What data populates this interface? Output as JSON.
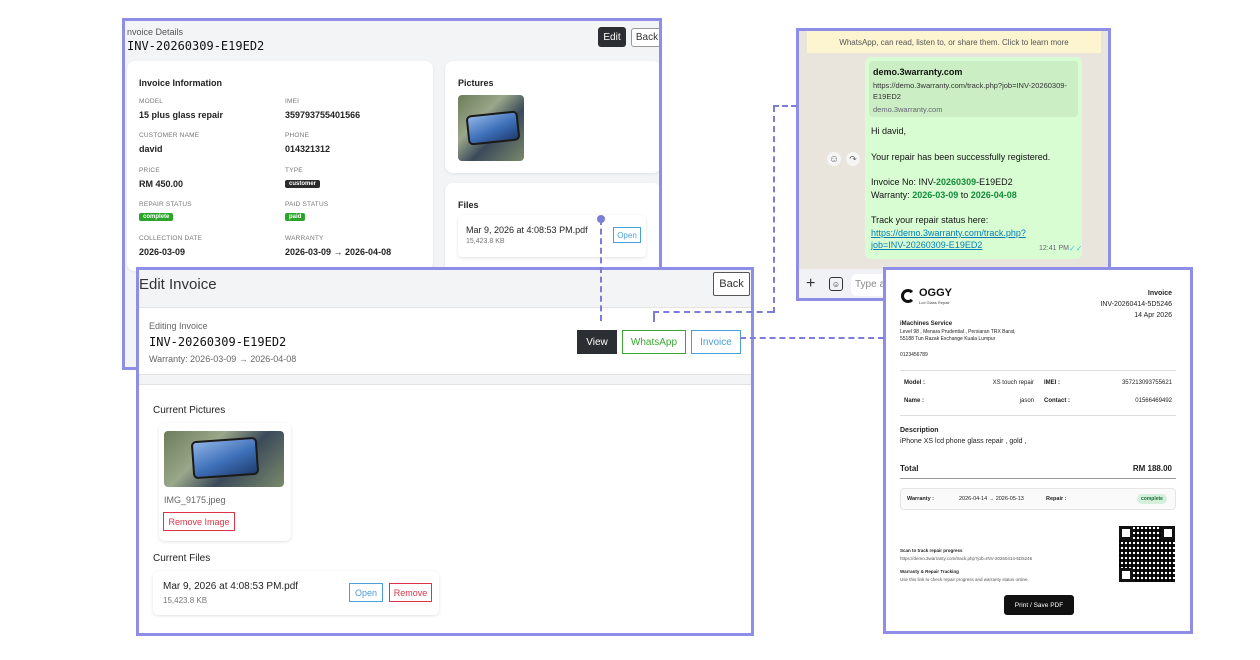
{
  "details": {
    "label": "nvoice Details",
    "invoice_id": "INV-20260309-E19ED2",
    "edit_label": "Edit",
    "back_label": "Back",
    "info_title": "Invoice Information",
    "model_label": "MODEL",
    "model": "15 plus glass repair",
    "imei_label": "IMEI",
    "imei": "359793755401566",
    "customer_label": "CUSTOMER NAME",
    "customer": "david",
    "phone_label": "PHONE",
    "phone": "014321312",
    "price_label": "PRICE",
    "price": "RM 450.00",
    "type_label": "TYPE",
    "type": "customer",
    "repair_status_label": "REPAIR STATUS",
    "repair_status": "complete",
    "paid_status_label": "PAID STATUS",
    "paid_status": "paid",
    "collection_label": "COLLECTION DATE",
    "collection": "2026-03-09",
    "warranty_label": "WARRANTY",
    "warranty": "2026-03-09 → 2026-04-08",
    "pictures_title": "Pictures",
    "files_title": "Files",
    "file_name": "Mar 9, 2026 at 4:08:53 PM.pdf",
    "file_size": "15,423.8 KB",
    "open_label": "Open"
  },
  "edit": {
    "title": "Edit Invoice",
    "back_label": "Back",
    "editing_label": "Editing Invoice",
    "invoice_id": "INV-20260309-E19ED2",
    "warranty": "Warranty: 2026-03-09 → 2026-04-08",
    "view_label": "View",
    "whatsapp_label": "WhatsApp",
    "invoice_label": "Invoice",
    "pictures_title": "Current Pictures",
    "image_name": "IMG_9175.jpeg",
    "remove_image_label": "Remove Image",
    "files_title": "Current Files",
    "file_name": "Mar 9, 2026 at 4:08:53 PM.pdf",
    "file_size": "15,423.8 KB",
    "open_label": "Open",
    "remove_label": "Remove"
  },
  "whatsapp": {
    "banner": "WhatsApp, can read, listen to, or share them. Click to learn more",
    "preview_title": "demo.3warranty.com",
    "preview_url_1": "https://demo.3warranty.com/track.php?job=INV-20260309-",
    "preview_url_2": "E19ED2",
    "preview_domain": "demo.3warranty.com",
    "greeting": "Hi david,",
    "registered": "Your repair has been successfully registered.",
    "invoice_prefix": "Invoice No: INV-",
    "invoice_bold": "20260309",
    "invoice_suffix": "-E19ED2",
    "warranty_prefix": "Warranty: ",
    "warranty_start": "2026-03-09",
    "warranty_to": " to ",
    "warranty_end": "2026-04-08",
    "track_text": "Track your repair status here:",
    "track_link_1": "https://demo.3warranty.com/track.php?",
    "track_link_2": "job=INV-20260309-E19ED2",
    "time": "12:41 PM",
    "input_placeholder": "Type a"
  },
  "receipt": {
    "brand": "OGGY",
    "brand_sub": "Lcd Glass Repair",
    "heading": "Invoice",
    "invoice_id": "INV-20260414-5D5246",
    "date": "14 Apr 2026",
    "shop_name": "iMachines Service",
    "address_1": "Level 98 , Menara Prudential , Persiaran TRX Barat,",
    "address_2": "55188 Tun Razak Exchange Kuala Lumpur",
    "shop_phone": "0123456789",
    "model_label": "Model :",
    "model": "XS touch repair",
    "imei_label": "IMEI :",
    "imei": "357213093755621",
    "name_label": "Name :",
    "name": "jason",
    "contact_label": "Contact :",
    "contact": "01566469492",
    "desc_title": "Description",
    "desc": "iPhone XS lcd phone glass repair , gold ,",
    "total_label": "Total",
    "total": "RM 188.00",
    "warranty_label": "Warranty :",
    "warranty": "2026-04-14 → 2026-05-13",
    "repair_label": "Repair :",
    "repair_status": "complete",
    "scan_title": "Scan to track repair progress",
    "scan_url": "https://demo.3warranty.com/track.php?job=INV-20260414-5D5246",
    "tracking_title": "Warranty & Repair Tracking",
    "tracking_desc": "Use this link to check repair progress and warranty status online.",
    "print_label": "Print / Save PDF"
  },
  "colors": {
    "frame": "#8e8ee8",
    "connector": "#7d7dd6",
    "whatsapp_green": "#3aa832",
    "invoice_blue": "#4a9fd8",
    "remove_red": "#dc3545"
  }
}
